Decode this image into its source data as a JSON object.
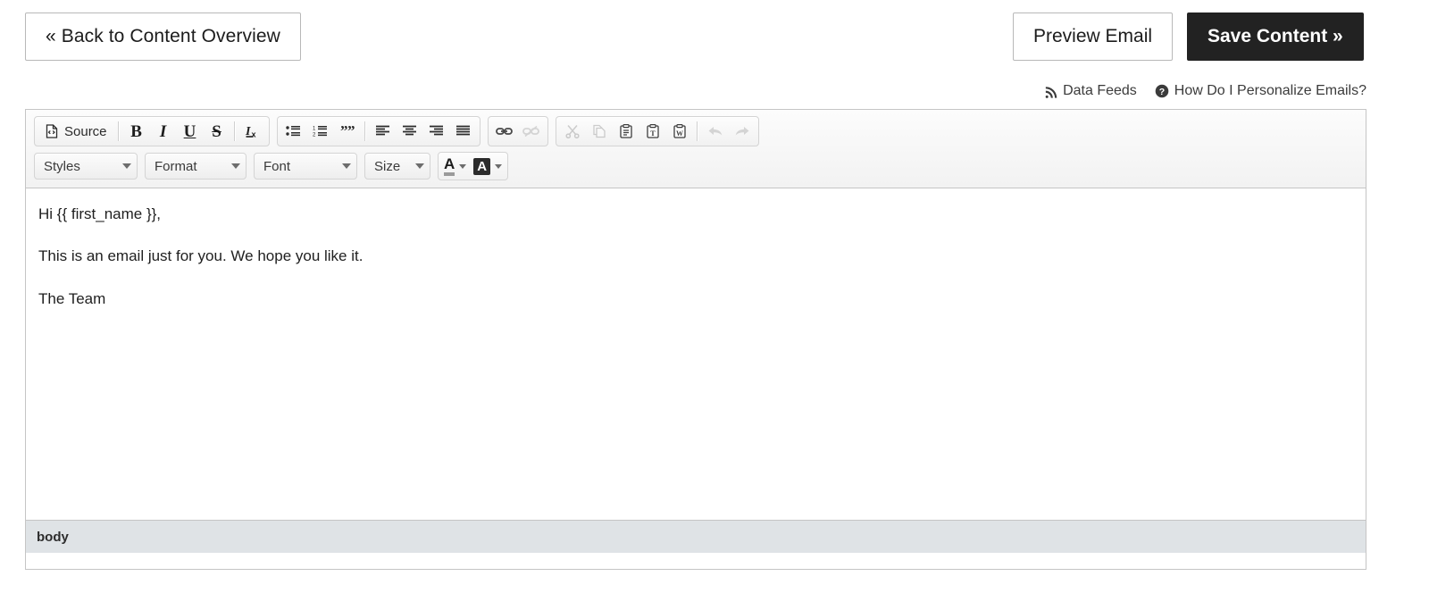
{
  "topbar": {
    "back_button": "« Back to Content Overview",
    "preview_button": "Preview Email",
    "save_button": "Save Content »"
  },
  "helpers": {
    "data_feeds": {
      "label": "Data Feeds",
      "icon": "rss-icon"
    },
    "personalize": {
      "label": "How Do I Personalize Emails?",
      "icon": "question-circle-icon"
    }
  },
  "editor": {
    "toolbar": {
      "row1": {
        "group1": [
          {
            "name": "source-button",
            "label": "Source",
            "icon": "source-code-icon",
            "disabled": false
          }
        ],
        "group1_formats": [
          {
            "name": "bold-button",
            "glyph": "B",
            "icon": "bold-icon"
          },
          {
            "name": "italic-button",
            "glyph": "I",
            "icon": "italic-icon"
          },
          {
            "name": "underline-button",
            "glyph": "U",
            "icon": "underline-icon"
          },
          {
            "name": "strikethrough-button",
            "glyph": "S",
            "icon": "strikethrough-icon"
          },
          {
            "name": "remove-format-button",
            "glyph": "Ix",
            "icon": "remove-format-icon"
          }
        ],
        "group2": [
          {
            "name": "bulleted-list-button",
            "icon": "bulleted-list-icon"
          },
          {
            "name": "numbered-list-button",
            "icon": "numbered-list-icon"
          },
          {
            "name": "blockquote-button",
            "icon": "blockquote-icon"
          },
          {
            "name": "align-left-button",
            "icon": "align-left-icon"
          },
          {
            "name": "align-center-button",
            "icon": "align-center-icon"
          },
          {
            "name": "align-right-button",
            "icon": "align-right-icon"
          },
          {
            "name": "align-justify-button",
            "icon": "align-justify-icon"
          }
        ],
        "group3": [
          {
            "name": "link-button",
            "icon": "link-icon",
            "disabled": false
          },
          {
            "name": "unlink-button",
            "icon": "unlink-icon",
            "disabled": true
          }
        ],
        "group4": [
          {
            "name": "cut-button",
            "icon": "scissors-icon",
            "disabled": true
          },
          {
            "name": "copy-button",
            "icon": "copy-icon",
            "disabled": true
          },
          {
            "name": "paste-button",
            "icon": "clipboard-icon",
            "disabled": false
          },
          {
            "name": "paste-as-text-button",
            "icon": "clipboard-text-icon",
            "disabled": false
          },
          {
            "name": "paste-from-word-button",
            "icon": "clipboard-word-icon",
            "disabled": false
          },
          {
            "name": "undo-button",
            "icon": "undo-arrow-icon",
            "disabled": true
          },
          {
            "name": "redo-button",
            "icon": "redo-arrow-icon",
            "disabled": true
          }
        ]
      },
      "row2": {
        "styles_label": "Styles",
        "format_label": "Format",
        "font_label": "Font",
        "size_label": "Size",
        "text_color": {
          "name": "text-color-button",
          "glyph": "A",
          "swatch": "#9a9a9a"
        },
        "bg_color": {
          "name": "background-color-button",
          "glyph": "A",
          "swatch": "#2b2b2b"
        }
      }
    },
    "body": {
      "paragraphs": [
        "Hi {{ first_name }},",
        "This is an email just for you. We hope you like it.",
        "The Team"
      ]
    },
    "statusbar": {
      "element_path": "body"
    }
  },
  "colors": {
    "save_button_bg": "#222222",
    "page_bg": "#ffffff",
    "toolbar_bg": "#f4f4f4",
    "statusbar_bg": "#dfe3e6",
    "border": "#c5c5c5"
  }
}
